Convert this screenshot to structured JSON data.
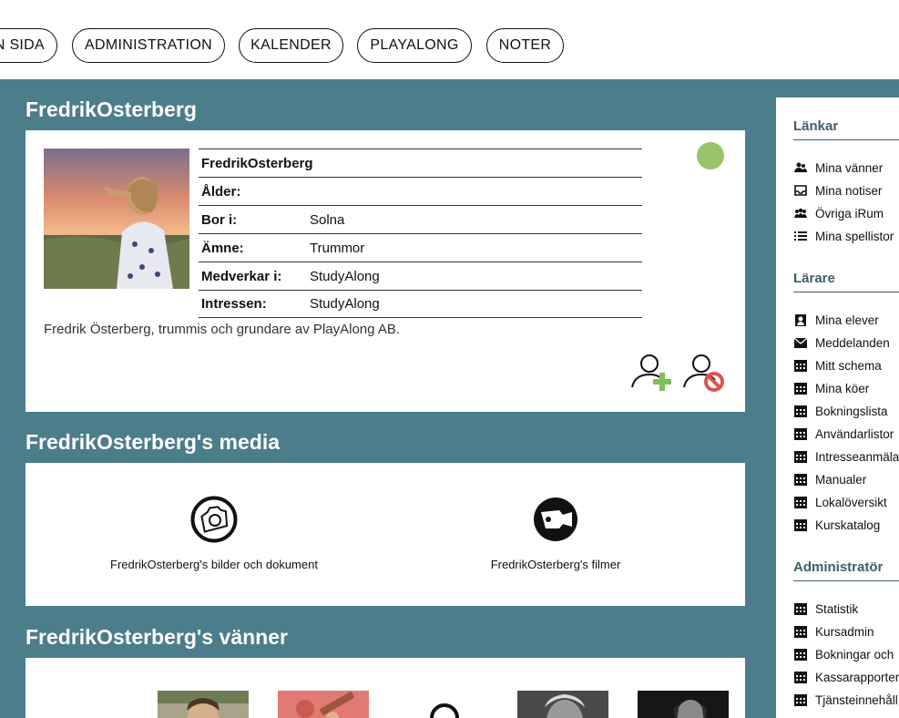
{
  "nav": {
    "items": [
      {
        "label": "N SIDA"
      },
      {
        "label": "ADMINISTRATION"
      },
      {
        "label": "KALENDER"
      },
      {
        "label": "PLAYALONG"
      },
      {
        "label": "NOTER"
      }
    ]
  },
  "profile": {
    "section_title": "FredrikOsterberg",
    "name": "FredrikOsterberg",
    "rows": [
      {
        "label": "Ålder:",
        "value": ""
      },
      {
        "label": "Bor i:",
        "value": "Solna"
      },
      {
        "label": "Ämne:",
        "value": "Trummor"
      },
      {
        "label": "Medverkar i:",
        "value": "StudyAlong"
      },
      {
        "label": "Intressen:",
        "value": "StudyAlong"
      }
    ],
    "bio": "Fredrik Österberg, trummis och grundare av PlayAlong AB.",
    "status_color": "#9ac26b"
  },
  "media": {
    "section_title": "FredrikOsterberg's media",
    "items": [
      {
        "label": "FredrikOsterberg's bilder och dokument",
        "icon": "camera-icon"
      },
      {
        "label": "FredrikOsterberg's filmer",
        "icon": "film-icon"
      }
    ]
  },
  "friends": {
    "section_title": "FredrikOsterberg's vänner"
  },
  "sidebar": {
    "sections": [
      {
        "title": "Länkar",
        "items": [
          {
            "label": "Mina vänner",
            "icon": "friends-icon"
          },
          {
            "label": "Mina notiser",
            "icon": "inbox-icon"
          },
          {
            "label": "Övriga iRum",
            "icon": "group-icon"
          },
          {
            "label": "Mina spellistor",
            "icon": "list-icon"
          }
        ]
      },
      {
        "title": "Lärare",
        "items": [
          {
            "label": "Mina elever",
            "icon": "contact-icon"
          },
          {
            "label": "Meddelanden",
            "icon": "mail-icon"
          },
          {
            "label": "Mitt schema",
            "icon": "calendar-icon"
          },
          {
            "label": "Mina köer",
            "icon": "calendar-icon"
          },
          {
            "label": "Bokningslista",
            "icon": "calendar-icon"
          },
          {
            "label": "Användarlistor",
            "icon": "calendar-icon"
          },
          {
            "label": "Intresseanmälan",
            "icon": "calendar-icon"
          },
          {
            "label": "Manualer",
            "icon": "calendar-icon"
          },
          {
            "label": "Lokalöversikt",
            "icon": "calendar-icon"
          },
          {
            "label": "Kurskatalog",
            "icon": "calendar-icon"
          }
        ]
      },
      {
        "title": "Administratör",
        "items": [
          {
            "label": "Statistik",
            "icon": "calendar-icon"
          },
          {
            "label": "Kursadmin",
            "icon": "calendar-icon"
          },
          {
            "label": "Bokningar och",
            "icon": "calendar-icon"
          },
          {
            "label": "Kassarapporter",
            "icon": "calendar-icon"
          },
          {
            "label": "Tjänsteinnehåll",
            "icon": "calendar-icon"
          }
        ]
      }
    ]
  },
  "colors": {
    "main_bg": "#4c7d8a",
    "accent_green": "#7cc05a",
    "block_red": "#d9534f"
  }
}
